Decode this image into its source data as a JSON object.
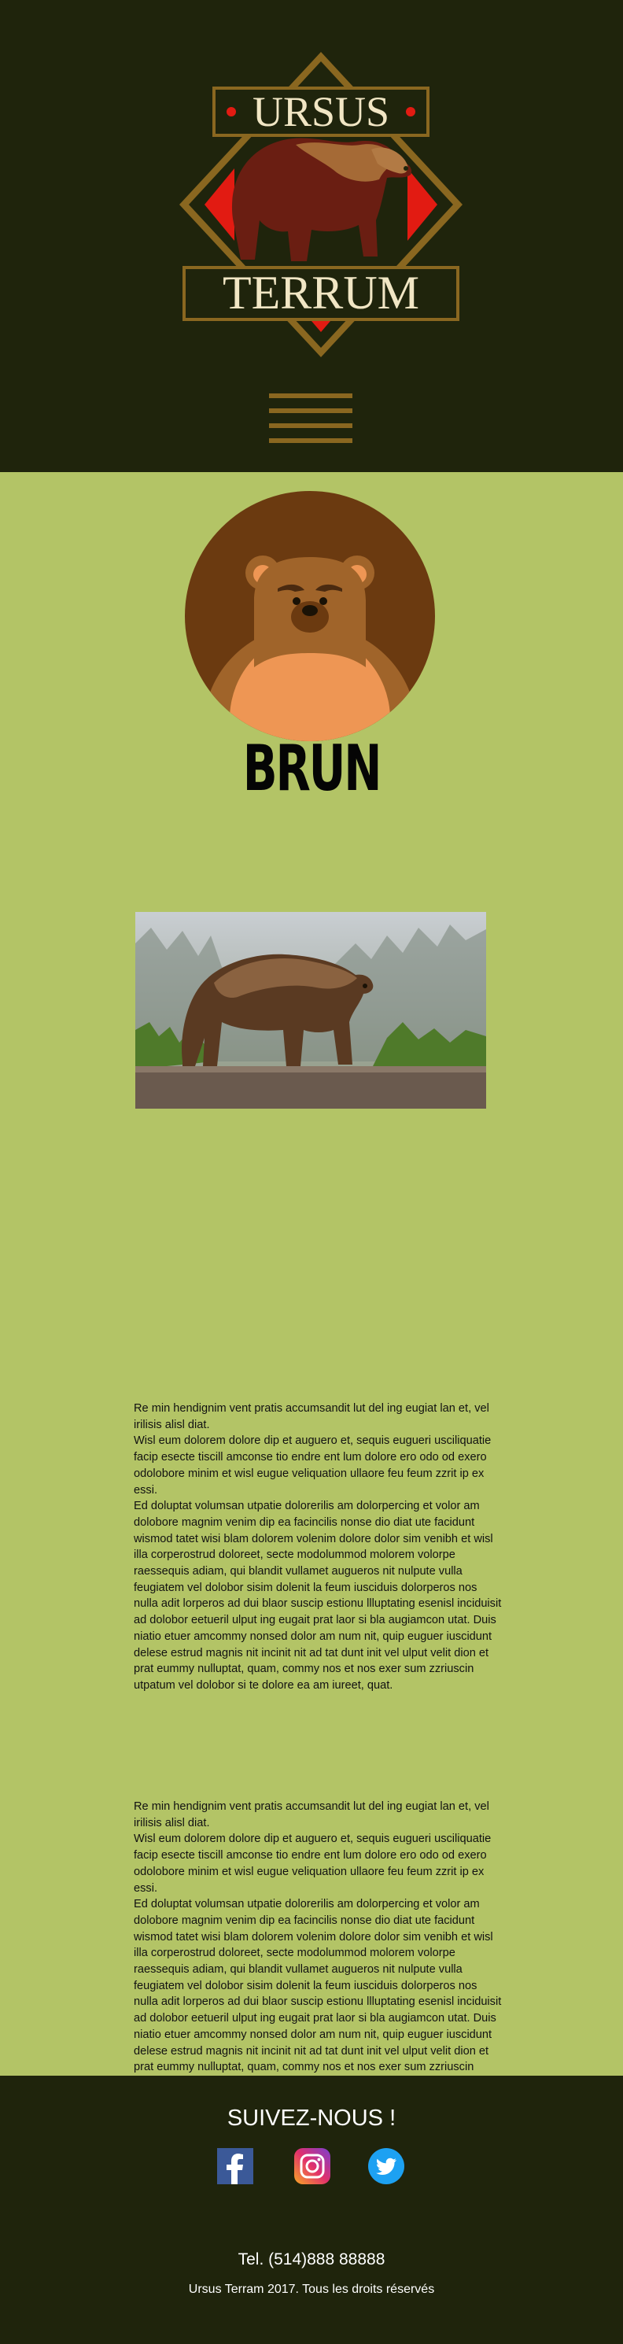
{
  "colors": {
    "dark_green": "#1f240c",
    "lime_green": "#b3c466",
    "bear_brown": "#7a4a2a",
    "logo_gold": "#8a6720",
    "logo_red": "#e21b12",
    "text_dark": "#111111"
  },
  "header": {
    "logo": {
      "line1": "URSUS",
      "line2": "TERRUM",
      "icon": "bear-logo-icon"
    },
    "menu_icon": "hamburger-menu-icon"
  },
  "main": {
    "avatar_icon": "bear-face-icon",
    "title": "BRUN",
    "photo_icon": "brown-bear-photo",
    "paragraphs": [
      "Re min hendignim vent pratis accumsandit lut del ing eugiat lan et, vel irilisis alisl diat.\nWisl eum dolorem dolore dip et auguero et, sequis eugueri usciliquatie facip esecte tiscill amconse tio endre ent lum dolore ero odo od exero odolobore minim et wisl eugue veliquation ullaore feu feum zzrit ip ex essi.\nEd doluptat volumsan utpatie dolorerilis am dolorpercing et volor am dolobore magnim venim dip ea facincilis nonse dio diat ute facidunt wismod tatet wisi blam dolorem volenim dolore dolor sim venibh et wisl illa corperostrud doloreet, secte modolummod molorem volorpe raessequis adiam, qui blandit vullamet augueros nit nulpute vulla feugiatem vel dolobor sisim dolenit la feum iusciduis dolorperos nos nulla adit lorperos ad dui blaor suscip estionu llluptating esenisl inciduisit ad dolobor eetueril ulput ing eugait prat laor si bla augiamcon utat. Duis niatio etuer amcommy nonsed dolor am num nit, quip euguer iuscidunt delese estrud magnis nit incinit nit ad tat dunt init vel ulput velit dion et prat eummy nulluptat, quam, commy nos et nos exer sum zzriuscin utpatum vel dolobor si te dolore ea am iureet, quat.",
      "Re min hendignim vent pratis accumsandit lut del ing eugiat lan et, vel irilisis alisl diat.\nWisl eum dolorem dolore dip et auguero et, sequis eugueri usciliquatie facip esecte tiscill amconse tio endre ent lum dolore ero odo od exero odolobore minim et wisl eugue veliquation ullaore feu feum zzrit ip ex essi.\nEd doluptat volumsan utpatie dolorerilis am dolorpercing et volor am dolobore magnim venim dip ea facincilis nonse dio diat ute facidunt wismod tatet wisi blam dolorem volenim dolore dolor sim venibh et wisl illa corperostrud doloreet, secte modolummod molorem volorpe raessequis adiam, qui blandit vullamet augueros nit nulpute vulla feugiatem vel dolobor sisim dolenit la feum iusciduis dolorperos nos nulla adit lorperos ad dui blaor suscip estionu llluptating esenisl inciduisit ad dolobor eetueril ulput ing eugait prat laor si bla augiamcon utat. Duis niatio etuer amcommy nonsed dolor am num nit, quip euguer iuscidunt delese estrud magnis nit incinit nit ad tat dunt init vel ulput velit dion et prat eummy nulluptat, quam, commy nos et nos exer sum zzriuscin utpatum vel dolobor si te dolore ea am iureet, quat."
    ]
  },
  "footer": {
    "follow": "SUIVEZ-NOUS !",
    "social": [
      {
        "icon": "facebook-icon",
        "color": "#3b5998"
      },
      {
        "icon": "instagram-icon",
        "color": "#c13584"
      },
      {
        "icon": "twitter-icon",
        "color": "#1da1f2"
      }
    ],
    "phone": "Tel. (514)888 88888",
    "copyright": "Ursus Terram 2017. Tous les droits réservés"
  }
}
